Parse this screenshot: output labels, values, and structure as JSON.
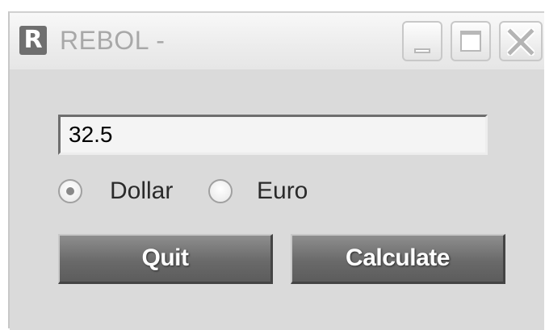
{
  "window": {
    "title": "REBOL -",
    "app_icon_letter": "R",
    "controls": [
      "minimize-icon",
      "maximize-icon",
      "close-icon"
    ]
  },
  "form": {
    "amount_value": "32.5",
    "currency_options": [
      {
        "label": "Dollar",
        "selected": true
      },
      {
        "label": "Euro",
        "selected": false
      }
    ],
    "buttons": {
      "quit_label": "Quit",
      "calculate_label": "Calculate"
    }
  },
  "colors": {
    "window_bg": "#dadada",
    "button_bg": "#6a6a6a",
    "button_text": "#ffffff",
    "title_text": "#a8a8a8"
  }
}
